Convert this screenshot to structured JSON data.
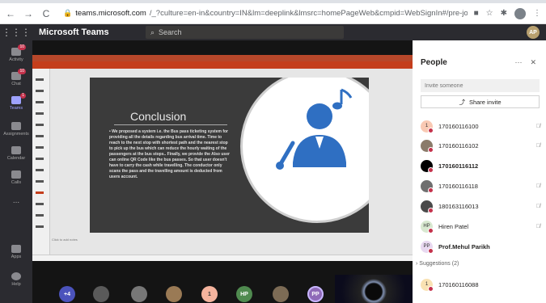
{
  "browser": {
    "url_host": "teams.microsoft.com",
    "url_rest": "/_?culture=en-in&country=IN&lm=deeplink&lmsrc=homePageWeb&cmpid=WebSignIn#/pre-join-calling/19:df24b9f5088d46da91c..."
  },
  "teams": {
    "app_title": "Microsoft Teams",
    "search_placeholder": "Search",
    "user_initials": "AP"
  },
  "rail": {
    "items": [
      {
        "label": "Activity",
        "badge": "10"
      },
      {
        "label": "Chat",
        "badge": "10"
      },
      {
        "label": "Teams",
        "badge": "1"
      },
      {
        "label": "Assignments",
        "badge": ""
      },
      {
        "label": "Calendar",
        "badge": ""
      },
      {
        "label": "Calls",
        "badge": ""
      },
      {
        "label": "...",
        "badge": ""
      },
      {
        "label": "Apps",
        "badge": ""
      },
      {
        "label": "Help",
        "badge": ""
      }
    ]
  },
  "slide": {
    "title": "Conclusion",
    "body": "We proposed a system i.e. the Bus pass ticketing system for providing all the details regarding bus arrival time. Time to reach to the next stop with shortest path and the nearest stop to pick up the bus which can reduce the hourly waiting of the passengers at the bus stops.. Finally, we provide the Also user can online QR Code like the bus passes. So that user doesn't have to carry the cash while travelling. The conductor only scans the pass and the travelling amount is deducted from users account.",
    "notes_hint": "Click to add notes"
  },
  "people": {
    "title": "People",
    "invite_placeholder": "Invite someone",
    "share_label": "Share invite",
    "participants": [
      {
        "name": "170160116100",
        "initials": "1",
        "color": "#f9c9b3",
        "muted": true,
        "bold": false
      },
      {
        "name": "170160116102",
        "initials": "",
        "color": "#8a7b6a",
        "muted": true,
        "bold": false
      },
      {
        "name": "170160116112",
        "initials": "",
        "color": "#000000",
        "muted": false,
        "bold": true
      },
      {
        "name": "170160116118",
        "initials": "",
        "color": "#6f6f6f",
        "muted": true,
        "bold": false
      },
      {
        "name": "180163116013",
        "initials": "",
        "color": "#4a4a4a",
        "muted": true,
        "bold": false
      },
      {
        "name": "Hiren Patel",
        "initials": "HP",
        "color": "#d8e8d0",
        "muted": true,
        "bold": false
      },
      {
        "name": "Prof.Mehul Parikh",
        "initials": "PP",
        "color": "#e8d8f0",
        "muted": false,
        "bold": true
      }
    ],
    "suggestions_label": "Suggestions (2)",
    "suggestions": [
      {
        "name": "170160116088",
        "initials": "1",
        "color": "#f9e2b3"
      }
    ]
  },
  "strip": {
    "more_count": "+4",
    "participants": [
      {
        "initials": "",
        "color": "#5a5a5a"
      },
      {
        "initials": "",
        "color": "#777777"
      },
      {
        "initials": "",
        "color": "#9a7a55"
      },
      {
        "initials": "1",
        "color": "#f4b39d"
      },
      {
        "initials": "HP",
        "color": "#4f8a4f"
      },
      {
        "initials": "",
        "color": "#7c6b55"
      },
      {
        "initials": "PP",
        "color": "#8f6ab8"
      }
    ]
  }
}
